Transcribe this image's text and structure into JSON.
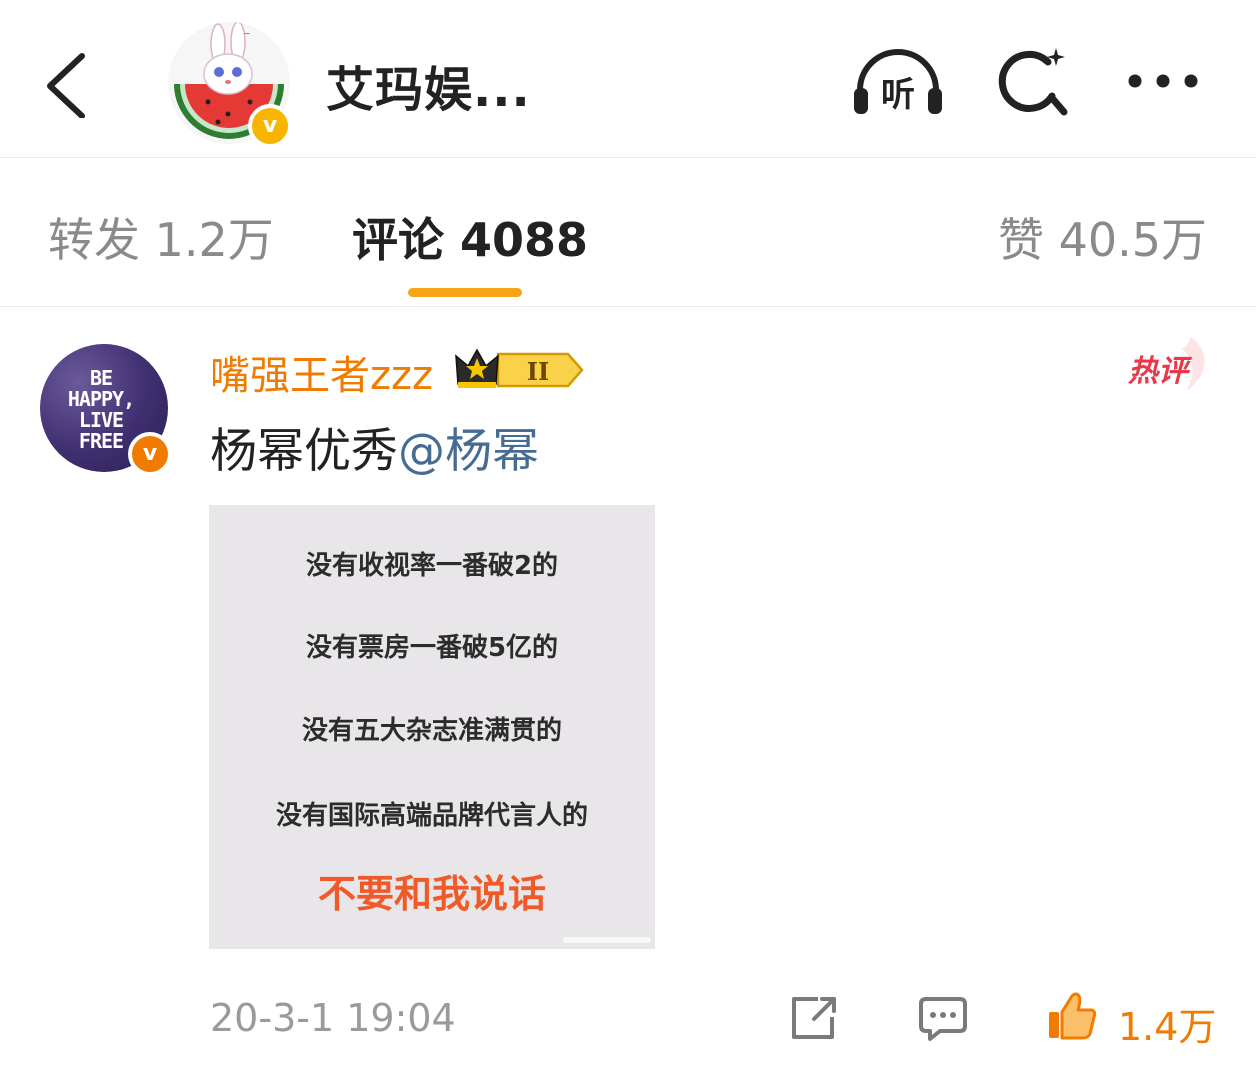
{
  "header": {
    "title": "艾玛娱...",
    "listen_label": "听",
    "back_icon": "back-arrow-icon",
    "verified_color": "#f7b500"
  },
  "tabs": [
    {
      "label": "转发 1.2万"
    },
    {
      "label": "评论 4088",
      "active": true
    },
    {
      "label": "赞 40.5万"
    }
  ],
  "accent_color": "#f7a416",
  "comment": {
    "username": "嘴强王者zzz",
    "level": "II",
    "hot_label": "热评",
    "text": "杨幂优秀",
    "mention": "@杨幂",
    "avatar_text": [
      "BE",
      "HAPPY,",
      "LIVE",
      "FREE"
    ],
    "image_lines": [
      "没有收视率一番破2的",
      "没有票房一番破5亿的",
      "没有五大杂志准满贯的",
      "没有国际高端品牌代言人的"
    ],
    "image_highlight": "不要和我说话",
    "time": "20-3-1 19:04",
    "likes": "1.4万",
    "verified_color": "#f07b00"
  }
}
